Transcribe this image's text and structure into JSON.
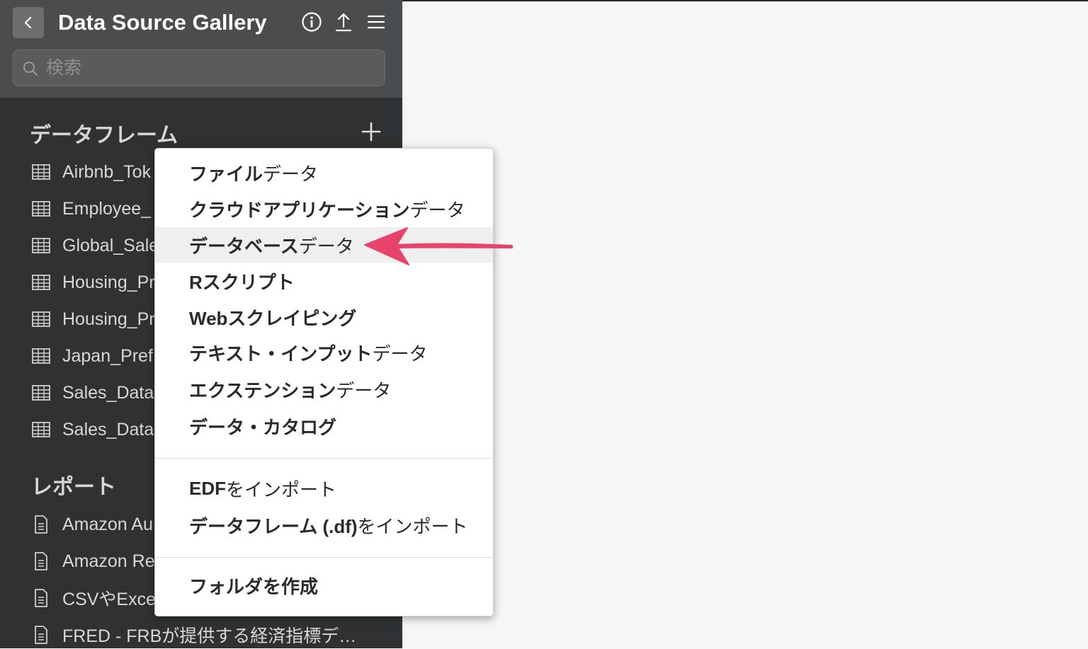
{
  "header": {
    "title": "Data Source Gallery",
    "icons": [
      "chevron-left-icon",
      "info-icon",
      "upload-icon",
      "menu-icon"
    ]
  },
  "search": {
    "placeholder": "検索"
  },
  "dataframes": {
    "title": "データフレーム",
    "items": [
      "Airbnb_Tok",
      "Employee_",
      "Global_Sale",
      "Housing_Pr",
      "Housing_Pr",
      "Japan_Pref",
      "Sales_Data",
      "Sales_Data"
    ]
  },
  "reports": {
    "title": "レポート",
    "items": [
      "Amazon Au",
      "Amazon Re",
      "CSVやExce",
      "FRED - FRBが提供する経済指標デ…"
    ]
  },
  "menu": {
    "items": [
      {
        "bold": "ファイル",
        "normal": "データ"
      },
      {
        "bold": "クラウドアプリケーション",
        "normal": "データ"
      },
      {
        "bold": "データベース",
        "normal": "データ"
      },
      {
        "bold": "Rスクリプト",
        "normal": ""
      },
      {
        "bold": "Webスクレイピング",
        "normal": ""
      },
      {
        "bold": "テキスト・インプット",
        "normal": "データ"
      },
      {
        "bold": "エクステンション",
        "normal": "データ"
      },
      {
        "bold": "データ・カタログ",
        "normal": ""
      },
      {
        "bold": "EDF",
        "normal": "をインポート"
      },
      {
        "bold": "データフレーム (.df)",
        "normal": "をインポート"
      },
      {
        "bold": "フォルダを作成",
        "normal": ""
      }
    ],
    "highlight_color": "#efefef"
  },
  "annotation": {
    "arrow_color": "#e8436b"
  }
}
